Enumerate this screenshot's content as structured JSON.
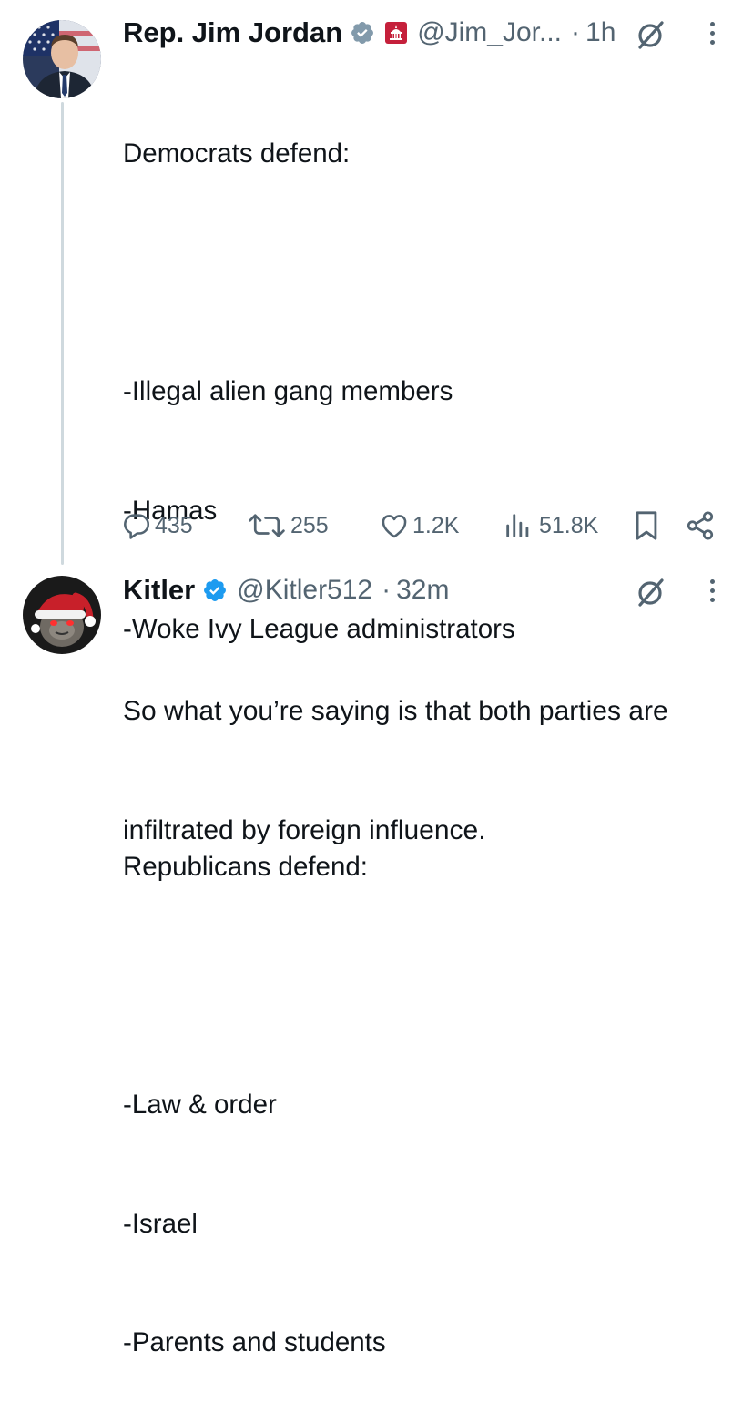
{
  "post1": {
    "author_name": "Rep. Jim Jordan",
    "handle": "@Jim_Jor...",
    "separator": "·",
    "time": "1h",
    "lines": [
      "Democrats defend:",
      "",
      "-Illegal alien gang members",
      "-Hamas",
      "-Woke Ivy League administrators",
      "",
      "Republicans defend:",
      "",
      "-Law & order",
      "-Israel",
      "-Parents and students"
    ],
    "stats": {
      "replies": "435",
      "reposts": "255",
      "likes": "1.2K",
      "views": "51.8K"
    },
    "verified_color": "#829aab",
    "affiliation_color": "#c5203b"
  },
  "post2": {
    "author_name": "Kitler",
    "handle": "@Kitler512",
    "separator": "·",
    "time": "32m",
    "lines": [
      "So what you’re saying is that both parties are",
      "infiltrated by foreign influence."
    ],
    "verified_color": "#1d9bf0"
  },
  "icons": {
    "post1": [
      "verified-badge",
      "affiliation-badge",
      "grok-icon",
      "more-icon",
      "reply-icon",
      "repost-icon",
      "like-icon",
      "views-icon",
      "bookmark-icon",
      "share-icon"
    ],
    "post2": [
      "verified-badge",
      "grok-icon",
      "more-icon"
    ]
  },
  "colors": {
    "text": "#0f1419",
    "secondary": "#536471",
    "thread_line": "#cfd9de"
  }
}
